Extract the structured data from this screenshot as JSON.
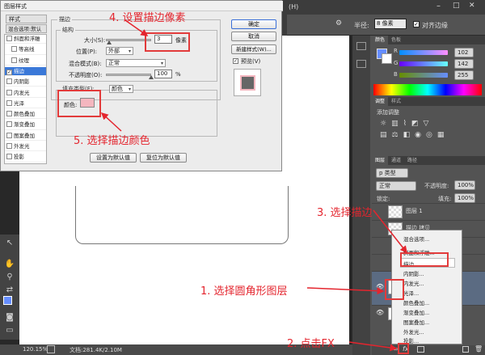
{
  "dialog": {
    "title": "图层样式",
    "styles_header": "样式",
    "blend_default": "混合选项:默认",
    "style_items": [
      {
        "label": "斜面和浮雕",
        "checked": false,
        "selected": false,
        "indent": false
      },
      {
        "label": "等高线",
        "checked": false,
        "selected": false,
        "indent": true
      },
      {
        "label": "纹理",
        "checked": false,
        "selected": false,
        "indent": true
      },
      {
        "label": "描边",
        "checked": true,
        "selected": true,
        "indent": false
      },
      {
        "label": "内阴影",
        "checked": false,
        "selected": false,
        "indent": false
      },
      {
        "label": "内发光",
        "checked": false,
        "selected": false,
        "indent": false
      },
      {
        "label": "光泽",
        "checked": false,
        "selected": false,
        "indent": false
      },
      {
        "label": "颜色叠加",
        "checked": false,
        "selected": false,
        "indent": false
      },
      {
        "label": "渐变叠加",
        "checked": false,
        "selected": false,
        "indent": false
      },
      {
        "label": "图案叠加",
        "checked": false,
        "selected": false,
        "indent": false
      },
      {
        "label": "外发光",
        "checked": false,
        "selected": false,
        "indent": false
      },
      {
        "label": "投影",
        "checked": false,
        "selected": false,
        "indent": false
      }
    ],
    "stroke_group": "描边",
    "structure_group": "结构",
    "size_label": "大小(S):",
    "size_value": "3",
    "size_unit": "像素",
    "position_label": "位置(P):",
    "position_value": "外部",
    "blend_label": "混合模式(B):",
    "blend_value": "正常",
    "opacity_label": "不透明度(O):",
    "opacity_value": "100",
    "opacity_unit": "%",
    "fill_type_label": "填充类型(F):",
    "fill_type_value": "颜色",
    "color_label": "颜色:",
    "stroke_color": "#f4b6bf",
    "btn_default_set": "设置为默认值",
    "btn_default_reset": "复位为默认值",
    "btn_ok": "确定",
    "btn_cancel": "取消",
    "btn_new_style": "新建样式(W)...",
    "preview_label": "预览(V)"
  },
  "annotations": {
    "a4": "4. 设置描边像素",
    "a5": "5. 选择描边颜色",
    "a3": "3. 选择描边",
    "a1": "1. 选择圆角形图层",
    "a2": "2. 点击FX"
  },
  "options_bar": {
    "menu_h": "(H)",
    "radius_label": "半径:",
    "radius_value": "8 像素",
    "align_edges": "对齐边缘"
  },
  "color_panel": {
    "tab_color": "颜色",
    "tab_swatch": "色板",
    "r_label": "R",
    "g_label": "G",
    "b_label": "B",
    "r": "102",
    "g": "142",
    "b": "255",
    "fg_color": "#668eff"
  },
  "adjust_panel": {
    "tab_adjust": "调整",
    "tab_style": "样式",
    "add_label": "添加调整"
  },
  "layers_panel": {
    "tab_layers": "图层",
    "tab_channels": "通道",
    "tab_paths": "路径",
    "kind": "p 类型",
    "blend_mode": "正常",
    "opacity_label": "不透明度:",
    "opacity": "100%",
    "lock_label": "锁定:",
    "fill_label": "填充:",
    "fill": "100%",
    "layers": [
      "图层 1",
      "描边 拷贝"
    ]
  },
  "context_menu": {
    "items": [
      "混合选项...",
      "斜面和浮雕...",
      "描边...",
      "内阴影...",
      "内发光...",
      "光泽...",
      "颜色叠加...",
      "渐变叠加...",
      "图案叠加...",
      "外发光...",
      "投影..."
    ]
  },
  "status": {
    "zoom": "120.15%",
    "doc": "文档:281.4K/2.10M"
  }
}
